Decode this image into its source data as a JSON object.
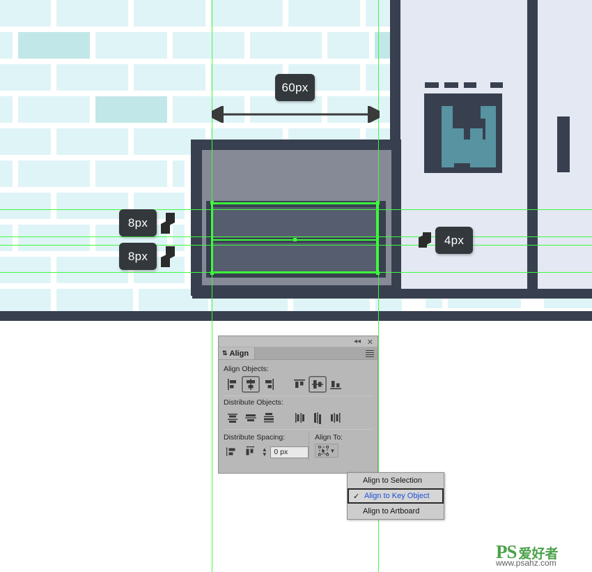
{
  "app": {
    "panel_title": "Align"
  },
  "panel": {
    "title": "Align",
    "sections": {
      "align_objects": "Align Objects:",
      "distribute_objects": "Distribute Objects:",
      "distribute_spacing": "Distribute Spacing:",
      "align_to": "Align To:"
    },
    "spacing_value": "0 px",
    "collapse_icon": "double-chevron-left-icon",
    "close_icon": "close-icon",
    "menu_icon": "panel-menu-icon",
    "align_objects_buttons": [
      {
        "name": "horizontal-align-left",
        "active": false
      },
      {
        "name": "horizontal-align-center",
        "active": true
      },
      {
        "name": "horizontal-align-right",
        "active": false
      },
      {
        "name": "vertical-align-top",
        "active": false
      },
      {
        "name": "vertical-align-center",
        "active": true
      },
      {
        "name": "vertical-align-bottom",
        "active": false
      }
    ],
    "distribute_objects_buttons": [
      {
        "name": "vertical-distribute-top",
        "active": false
      },
      {
        "name": "vertical-distribute-center",
        "active": false
      },
      {
        "name": "vertical-distribute-bottom",
        "active": false
      },
      {
        "name": "horizontal-distribute-left",
        "active": false
      },
      {
        "name": "horizontal-distribute-center",
        "active": false
      },
      {
        "name": "horizontal-distribute-right",
        "active": false
      }
    ],
    "distribute_spacing_buttons": [
      {
        "name": "vertical-distribute-spacing",
        "active": false
      },
      {
        "name": "horizontal-distribute-spacing",
        "active": false
      }
    ]
  },
  "align_menu": {
    "items": [
      {
        "label": "Align to Selection",
        "selected": false
      },
      {
        "label": "Align to Key Object",
        "selected": true
      },
      {
        "label": "Align to Artboard",
        "selected": false
      }
    ]
  },
  "measurements": [
    {
      "label": "60px",
      "orientation": "horizontal"
    },
    {
      "label": "8px",
      "orientation": "vertical"
    },
    {
      "label": "8px",
      "orientation": "vertical"
    },
    {
      "label": "4px",
      "orientation": "vertical"
    }
  ],
  "colors": {
    "guide_green": "#3dfb3d",
    "brick_light": "#dff4f7",
    "brick_accent": "#c2e7e8",
    "dark_panel": "#383f4f",
    "light_panel": "#e4e8f2",
    "grey_panel": "#868a96",
    "mid_grey": "#565d6e",
    "teal": "#5793a1",
    "badge_bg": "#33383c",
    "menu_selected_text": "#1b4fd8"
  },
  "watermark": {
    "brand": "PS",
    "brand_cn": "爱好者",
    "url": "www.psahz.com"
  }
}
